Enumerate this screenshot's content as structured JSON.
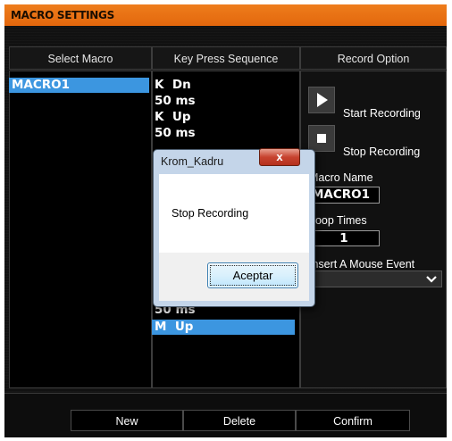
{
  "window": {
    "title": "MACRO SETTINGS"
  },
  "columns": {
    "select_macro": "Select Macro",
    "key_press_sequence": "Key Press Sequence",
    "record_option": "Record Option"
  },
  "macros": [
    "MACRO1"
  ],
  "sequence_top": [
    "K  Dn",
    "50 ms",
    "K  Up",
    "50 ms"
  ],
  "sequence_bottom": [
    "50 ms",
    "M  Up"
  ],
  "record": {
    "start_label": "Start Recording",
    "stop_label": "Stop Recording",
    "macro_name_label": "Macro Name",
    "macro_name_value": "MACRO1",
    "loop_times_label": "Loop Times",
    "loop_times_value": "1",
    "mouse_event_label": "Insert A Mouse Event"
  },
  "buttons": {
    "new": "New",
    "delete": "Delete",
    "confirm": "Confirm"
  },
  "dialog": {
    "title": "Krom_Kadru",
    "close": "x",
    "message": "Stop Recording",
    "ok": "Aceptar"
  }
}
